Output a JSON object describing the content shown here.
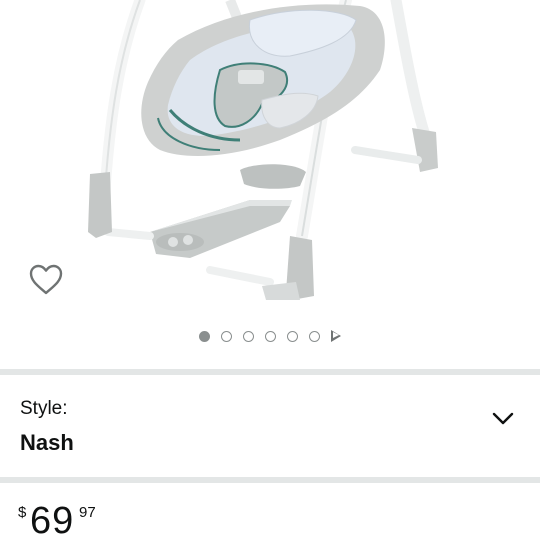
{
  "product": {
    "image_alt": "baby swing",
    "gallery_count": 6,
    "active_index": 1
  },
  "wishlist": {
    "icon": "heart-outline-icon"
  },
  "style_selector": {
    "label": "Style:",
    "value": "Nash",
    "icon": "chevron-down-icon"
  },
  "price": {
    "symbol": "$",
    "whole": "69",
    "fraction": "97"
  },
  "colors": {
    "divider": "#e3e6e6",
    "dot": "#8a8f8f",
    "accent_teal": "#3f7f77"
  }
}
